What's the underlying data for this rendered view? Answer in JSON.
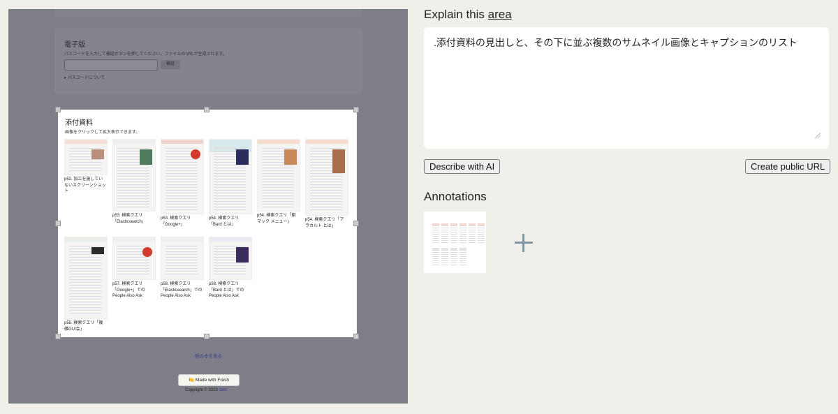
{
  "screenshot": {
    "ebook": {
      "title": "電子版",
      "description": "パスコードを入力して検証ボタンを押してください。ファイルのURLが生成されます。",
      "verify_button": "検証",
      "passcode_link": "▸ パスコードについて"
    },
    "attachments": {
      "title": "添付資料",
      "subtitle": "画像をクリックして拡大表示できます。",
      "items": [
        {
          "caption": "p52. 加工を施してい\nないスクリーンショッ\nト"
        },
        {
          "caption": "p53. 検索クエリ\n「Elasticsearch」"
        },
        {
          "caption": "p53. 検索クエリ\n「Google+」"
        },
        {
          "caption": "p54. 検索クエリ\n「Bard とは」"
        },
        {
          "caption": "p54. 検索クエリ「朝\nマック メニュー」"
        },
        {
          "caption": "p54. 検索クエリ「ア\nラカルト とは」"
        },
        {
          "caption": "p55. 検索クエリ「複\n雑GUI会」"
        },
        {
          "caption": "p57. 検索クエリ\n「Google+」での\nPeople Also Ask"
        },
        {
          "caption": "p58. 検索クエリ\n「Elasticsearch」での\nPeople Also Ask"
        },
        {
          "caption": "p58. 検索クエリ\n「Bard とは」での\nPeople Also Ask"
        }
      ]
    },
    "others_link": "他の本を見る",
    "made_with": "Made with Fresh",
    "copyright": "Copyright © 2023",
    "copyright_link": "dalo"
  },
  "panel": {
    "explain_prefix": "Explain this",
    "explain_link": "area",
    "description": ".添付資料の見出しと、その下に並ぶ複数のサムネイル画像とキャプションのリスト",
    "describe_button": "Describe with AI",
    "public_url_button": "Create public URL",
    "annotations_title": "Annotations"
  },
  "colors": {
    "overlay": "#7d7e87",
    "page_background": "#f0efe9",
    "add_icon": "#7f98a6"
  }
}
